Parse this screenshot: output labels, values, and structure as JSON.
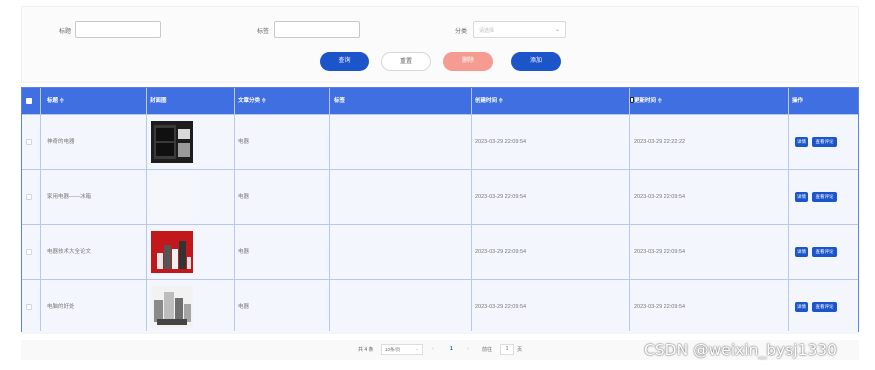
{
  "filter": {
    "title_label": "标题",
    "tag_label": "标签",
    "category_label": "分类",
    "category_placeholder": "请选择",
    "title_value": "",
    "tag_value": "",
    "search_btn": "查询",
    "reset_btn": "重置",
    "delete_btn": "删除",
    "add_btn": "添加"
  },
  "table": {
    "headers": {
      "title": "标题 ≑",
      "cover": "封面图",
      "category": "文章分类 ≑",
      "tags": "标签",
      "created": "创建时间 ≑",
      "updated": "更新时间 ≑",
      "actions": "操作"
    },
    "rows": [
      {
        "title": "神奇的电器",
        "category": "电器",
        "tags": "",
        "created": "2023-03-29 22:09:54",
        "updated": "2023-03-29 22:22:22",
        "cover": "black-appliance-photo"
      },
      {
        "title": "家用电器——冰箱",
        "category": "电器",
        "tags": "",
        "created": "2023-03-29 22:09:54",
        "updated": "2023-03-29 22:09:54",
        "cover": "blank"
      },
      {
        "title": "电器技术大全论文",
        "category": "电器",
        "tags": "",
        "created": "2023-03-29 22:09:54",
        "updated": "2023-03-29 22:09:54",
        "cover": "red-appliances-photo"
      },
      {
        "title": "电脑的好处",
        "category": "电器",
        "tags": "",
        "created": "2023-03-29 22:09:54",
        "updated": "2023-03-29 22:09:54",
        "cover": "silver-appliances-photo"
      }
    ],
    "row_actions": {
      "detail": "详情",
      "comments": "查看评论"
    }
  },
  "pagination": {
    "total": "共 4 条",
    "page_size": "10条/页",
    "prev": "‹",
    "current_page": "1",
    "next": "›",
    "goto_label": "前往",
    "goto_value": "1",
    "goto_suffix": "页"
  },
  "watermark": "CSDN @weixin_bysj1330",
  "colors": {
    "primary": "#1c54c9",
    "header": "#3f6fe0",
    "delete": "#f59b92",
    "row": "#f3f6fc"
  }
}
